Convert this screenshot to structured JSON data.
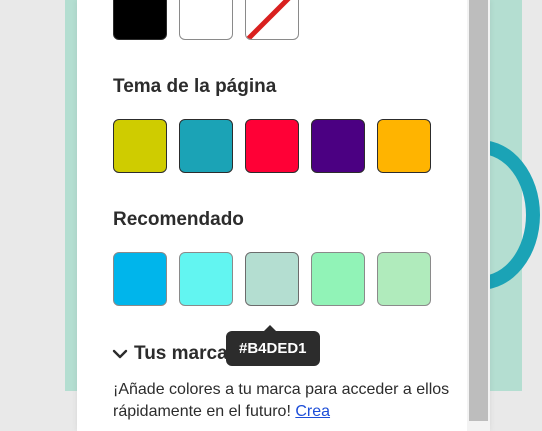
{
  "colors": {
    "canvas_background": "#b4ded1",
    "panel_background": "#ffffff",
    "tooltip_background": "#2c2c2c",
    "link": "#1d4ed8"
  },
  "top_row": {
    "swatches": [
      {
        "color": "#000000",
        "name": "black"
      },
      {
        "color": "#ffffff",
        "name": "white"
      },
      {
        "color": "none",
        "name": "no-color"
      }
    ]
  },
  "page_theme": {
    "title": "Tema de la página",
    "swatches": [
      "#cfcc00",
      "#1ba3b6",
      "#ff0036",
      "#4b0082",
      "#ffb400"
    ]
  },
  "recommended": {
    "title": "Recomendado",
    "swatches": [
      "#00b5eb",
      "#62f5f1",
      "#b4ded1",
      "#91f3b7",
      "#b0ebbc"
    ]
  },
  "tooltip": {
    "text": "#B4DED1"
  },
  "brands": {
    "title": "Tus marcas",
    "description": "¡Añade colores a tu marca para acceder a ellos rápidamente en el futuro! ",
    "link_text": "Crea"
  }
}
